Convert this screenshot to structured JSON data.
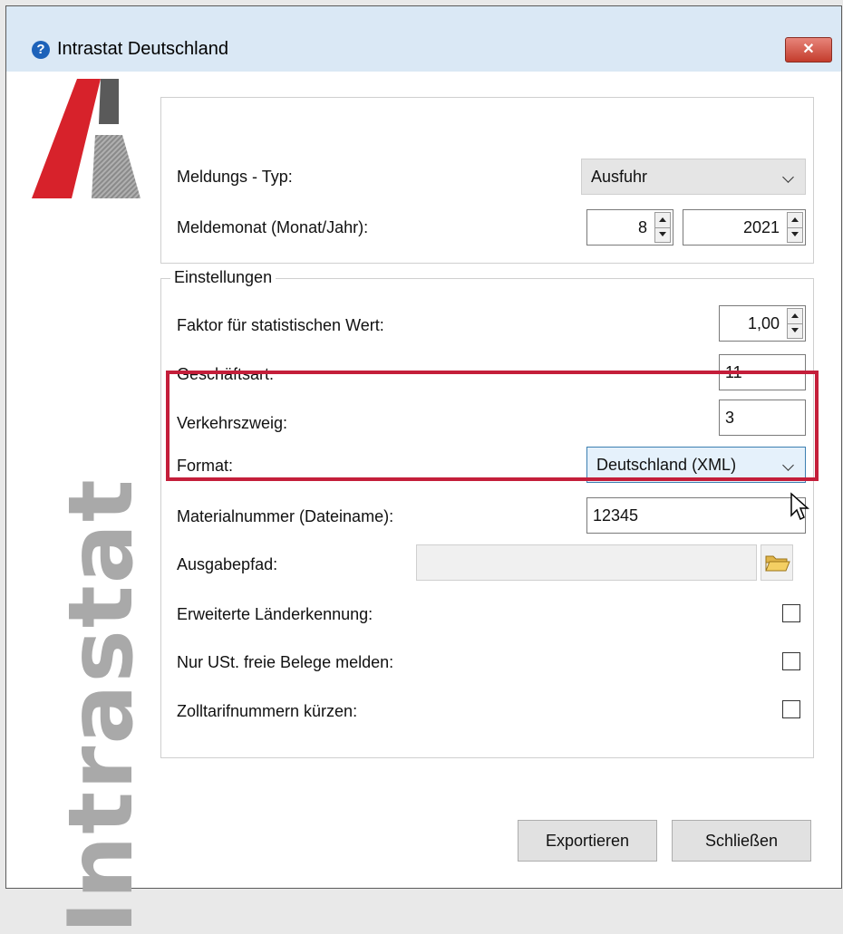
{
  "window": {
    "title": "Intrastat Deutschland",
    "help_icon": "question-circle-icon",
    "close_glyph": "✕"
  },
  "brand": {
    "vertical_text": "Intrastat",
    "logo_colors": [
      "#d7222b",
      "#5a5a5a"
    ]
  },
  "report": {
    "type_label": "Meldungs - Typ:",
    "type_value": "Ausfuhr",
    "month_label": "Meldemonat (Monat/Jahr):",
    "month_value": "8",
    "year_value": "2021"
  },
  "settings": {
    "legend": "Einstellungen",
    "factor_label": "Faktor für statistischen Wert:",
    "factor_value": "1,00",
    "business_label": "Geschäftsart:",
    "business_value": "11",
    "transport_label": "Verkehrszweig:",
    "transport_value": "3",
    "format_label": "Format:",
    "format_value": "Deutschland (XML)",
    "material_label": "Materialnummer (Dateiname):",
    "material_value": "12345",
    "output_label": "Ausgabepfad:",
    "output_value": "",
    "ext_country_label": "Erweiterte Länderkennung:",
    "ext_country_checked": false,
    "vat_free_label": "Nur USt. freie Belege melden:",
    "vat_free_checked": false,
    "tariff_label": "Zolltarifnummern kürzen:",
    "tariff_checked": false
  },
  "buttons": {
    "export": "Exportieren",
    "close": "Schließen"
  },
  "colors": {
    "highlight": "#c41e3a",
    "focus_border": "#3c7fb1",
    "title_bar": "#dae8f5"
  }
}
